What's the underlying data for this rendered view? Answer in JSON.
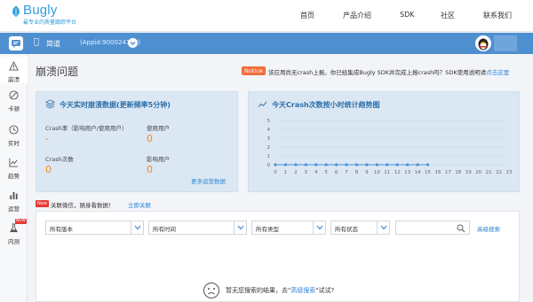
{
  "brand": {
    "name": "Bugly",
    "tagline": "最专业的质量跟踪平台"
  },
  "topnav": {
    "items": [
      "首页",
      "产品介绍",
      "SDK",
      "社区",
      "联系我们"
    ]
  },
  "appbar": {
    "app_name": "简道",
    "app_id": "(Appid:900024757)"
  },
  "sidebar": {
    "items": [
      {
        "label": "崩溃",
        "icon": "warning-icon",
        "active": true
      },
      {
        "label": "卡顿",
        "icon": "stall-icon"
      },
      {
        "label": "实时",
        "icon": "clock-icon"
      },
      {
        "label": "趋势",
        "icon": "trend-icon"
      },
      {
        "label": "运营",
        "icon": "bar-chart-icon"
      },
      {
        "label": "内测",
        "icon": "beta-icon",
        "badge": "NEW"
      }
    ]
  },
  "header": {
    "title": "崩溃问题",
    "notice_tag": "Notice",
    "notice_text": "该应用尚无crash上报。你已经集成Bugly SDK并完成上报crash吗？SDK使用说明请",
    "notice_link": "点击这里"
  },
  "realtime_panel": {
    "title": "今天实时崩溃数据(更新频率5分钟)",
    "crash_rate_label": "Crash率（影响用户/使用用户）",
    "crash_rate_value": "-",
    "users_label": "使用用户",
    "users_value": "0",
    "crash_count_label": "Crash次数",
    "crash_count_value": "0",
    "affected_label": "影响用户",
    "affected_value": "0",
    "more_link": "更多运营数据"
  },
  "trend_panel": {
    "title": "今天Crash次数按小时统计趋势图"
  },
  "chart_data": {
    "type": "line",
    "title": "今天Crash次数按小时统计趋势图",
    "xlabel": "",
    "ylabel": "",
    "x": [
      "0",
      "1",
      "2",
      "3",
      "4",
      "5",
      "6",
      "7",
      "8",
      "9",
      "10",
      "11",
      "12",
      "13",
      "14",
      "15",
      "16",
      "17",
      "18",
      "19",
      "20",
      "21",
      "22",
      "23"
    ],
    "series": [
      {
        "values": [
          0,
          0,
          0,
          0,
          0,
          0,
          0,
          0,
          0,
          0,
          0,
          0,
          0,
          0,
          0,
          0
        ]
      }
    ],
    "y_ticks": [
      "0",
      "1",
      "2",
      "3",
      "4",
      "5"
    ],
    "ylim": [
      0,
      5
    ],
    "grid": true
  },
  "follow_bar": {
    "new_tag": "New",
    "text": "关联微信，随身看数据！",
    "link": "立即关联"
  },
  "filters": {
    "version": "所有版本",
    "time": "所有时间",
    "type": "所有类型",
    "status": "所有状态",
    "search_value": "",
    "advanced_search": "高级搜索"
  },
  "empty_state": {
    "text_before": "暂无您搜索的结果，去\"",
    "link": "高级搜索",
    "text_after": "\"试试?"
  },
  "colors": {
    "brand": "#2f9ce0",
    "appbar": "#4e8fd0",
    "panel": "#dbe8f4",
    "value": "#f08a1c",
    "chart_point": "#4a90d9",
    "notice": "#f06e3c"
  }
}
